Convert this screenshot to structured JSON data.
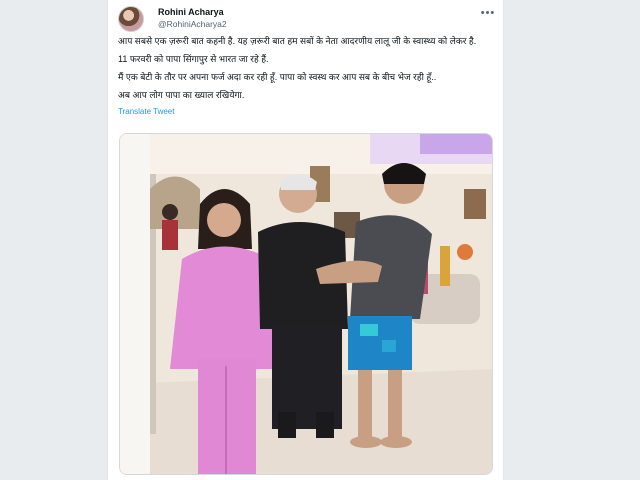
{
  "tweet": {
    "author_name": "Rohini Acharya",
    "author_handle": "@RohiniAcharya2",
    "more_icon": "more-horizontal-icon",
    "paragraphs": [
      "आप सबसे एक ज़रूरी बात कहनी है. यह ज़रूरी बात हम सबों के नेता आदरणीय लालू जी के स्वास्थ्य को लेकर है.",
      "11 फरवरी को पापा सिंगापुर से भारत जा रहे हैं.",
      "मैं एक बेटी के तौर पर अपना फर्ज अदा कर रही हूँ. पापा को स्वस्थ कर आप सब के बीच भेज रही हूँ..",
      "अब आप लोग पापा का ख्याल रखियेगा."
    ],
    "translate_label": "Translate Tweet"
  },
  "colors": {
    "link": "#1d9bf0",
    "text": "#0f1419",
    "muted": "#536471"
  }
}
